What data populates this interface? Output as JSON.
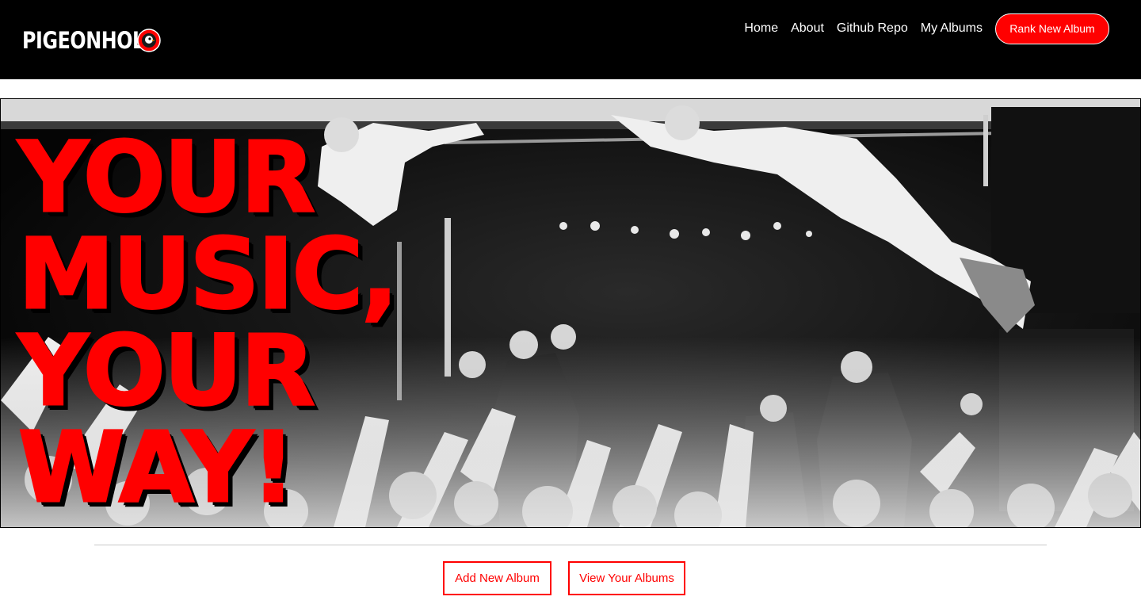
{
  "brand": {
    "name": "PIGEONHOLE",
    "logo_icon": "pigeon-record-icon"
  },
  "nav": {
    "links": [
      "Home",
      "About",
      "Github Repo",
      "My Albums"
    ],
    "cta_label": "Rank New Album"
  },
  "hero": {
    "headline": [
      "YOUR",
      "MUSIC,",
      "YOUR",
      "WAY!"
    ],
    "image": "black-and-white concert stage-dive photo"
  },
  "actions": {
    "add_label": "Add New Album",
    "view_label": "View Your Albums"
  },
  "colors": {
    "accent": "#ff0000",
    "navbar": "#000000",
    "background": "#ffffff"
  }
}
